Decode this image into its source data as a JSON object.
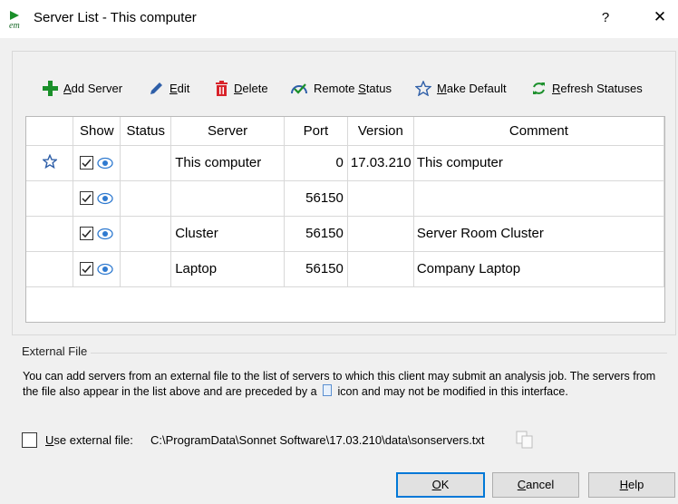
{
  "window": {
    "title": "Server List - This computer",
    "help_glyph": "?",
    "close_glyph": "✕"
  },
  "toolbar": {
    "add_server": {
      "accel": "A",
      "rest": "dd Server",
      "icon": "plus-icon"
    },
    "edit": {
      "accel": "E",
      "rest": "dit",
      "icon": "pencil-icon"
    },
    "delete": {
      "accel": "D",
      "rest": "elete",
      "icon": "trash-icon"
    },
    "remote_status": {
      "pre": "Remote ",
      "accel": "S",
      "rest": "tatus",
      "icon": "gauge-check-icon"
    },
    "make_default": {
      "accel": "M",
      "rest": "ake Default",
      "icon": "star-icon"
    },
    "refresh_statuses": {
      "accel": "R",
      "rest": "efresh Statuses",
      "icon": "refresh-icon"
    }
  },
  "table": {
    "headers": [
      "",
      "Show",
      "Status",
      "Server",
      "Port",
      "Version",
      "Comment"
    ],
    "rows": [
      {
        "default": true,
        "show": true,
        "status": "",
        "server": "This computer",
        "port": "0",
        "version": "17.03.210",
        "comment": "This computer"
      },
      {
        "default": false,
        "show": true,
        "status": "",
        "server": "",
        "port": "56150",
        "version": "",
        "comment": ""
      },
      {
        "default": false,
        "show": true,
        "status": "",
        "server": "Cluster",
        "port": "56150",
        "version": "",
        "comment": "Server Room Cluster"
      },
      {
        "default": false,
        "show": true,
        "status": "",
        "server": "Laptop",
        "port": "56150",
        "version": "",
        "comment": "Company Laptop"
      }
    ]
  },
  "external": {
    "section_title": "External File",
    "desc_part1": "You can add servers from an external file to the list of servers to which this client may submit an analysis job. The servers from the file also appear in the list above and are preceded by a",
    "desc_part2": "icon and may not be modified in this interface.",
    "checkbox": {
      "accel": "U",
      "rest": "se external file:",
      "checked": false
    },
    "path": "C:\\ProgramData\\Sonnet Software\\17.03.210\\data\\sonservers.txt"
  },
  "buttons": {
    "ok": {
      "accel": "O",
      "rest": "K"
    },
    "cancel": {
      "accel": "C",
      "rest": "ancel"
    },
    "help": {
      "accel": "H",
      "rest": "elp"
    }
  },
  "colors": {
    "accent": "#0078d7",
    "add_green": "#1a8f2a",
    "delete_red": "#d8232a",
    "icon_blue": "#2f5fa8"
  }
}
